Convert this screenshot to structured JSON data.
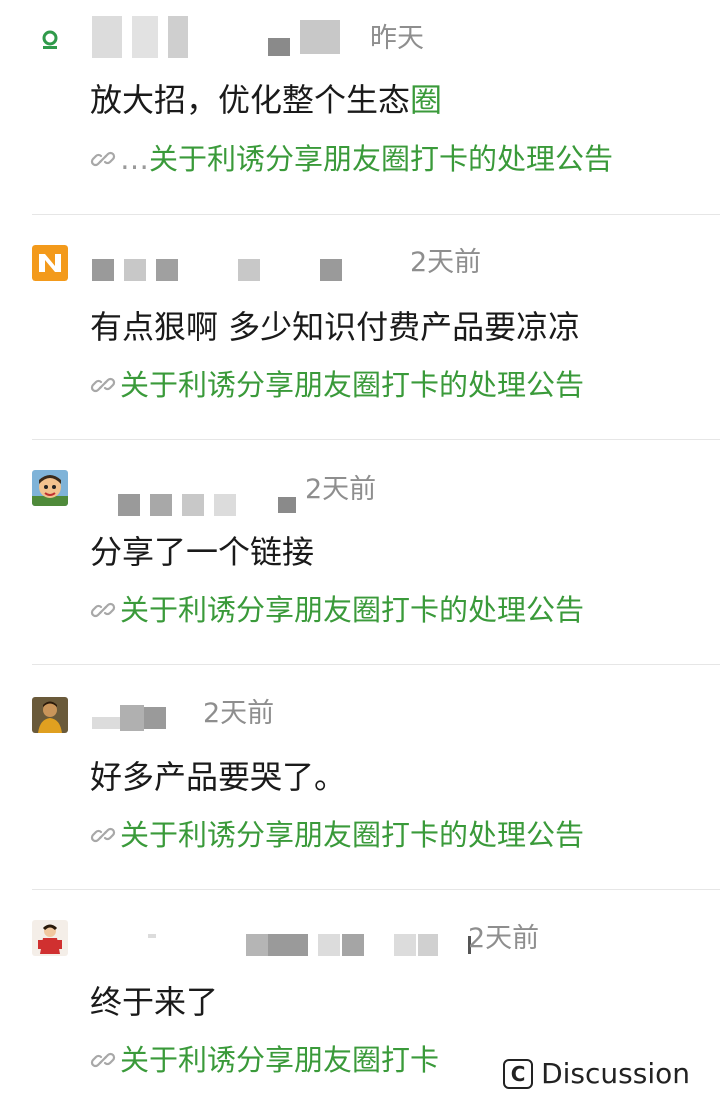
{
  "feed": {
    "items": [
      {
        "time": "昨天",
        "comment_main": "放大招，优化整个生态",
        "comment_tail": "圈",
        "link_prefix": "…",
        "link_text": "关于利诱分享朋友圈打卡的处理公告",
        "avatar_icon": "green-app-logo-icon"
      },
      {
        "time": "2天前",
        "comment": "有点狠啊 多少知识付费产品要凉凉",
        "link_text": "关于利诱分享朋友圈打卡的处理公告",
        "avatar_icon": "orange-n-logo-icon"
      },
      {
        "time": "2天前",
        "comment": "分享了一个链接",
        "link_text": "关于利诱分享朋友圈打卡的处理公告",
        "avatar_icon": "cartoon-face-avatar"
      },
      {
        "time": "2天前",
        "comment": "好多产品要哭了。",
        "link_text": "关于利诱分享朋友圈打卡的处理公告",
        "avatar_icon": "person-photo-avatar"
      },
      {
        "time": "2天前",
        "comment": "终于来了",
        "link_text": "关于利诱分享朋友圈打卡",
        "avatar_icon": "red-figure-avatar"
      }
    ]
  },
  "watermark": {
    "label": "Discussion",
    "icon": "c-letter-icon"
  },
  "colors": {
    "link_green": "#3a9a3a",
    "time_gray": "#8e8e8e",
    "text": "#1a1a1a"
  }
}
